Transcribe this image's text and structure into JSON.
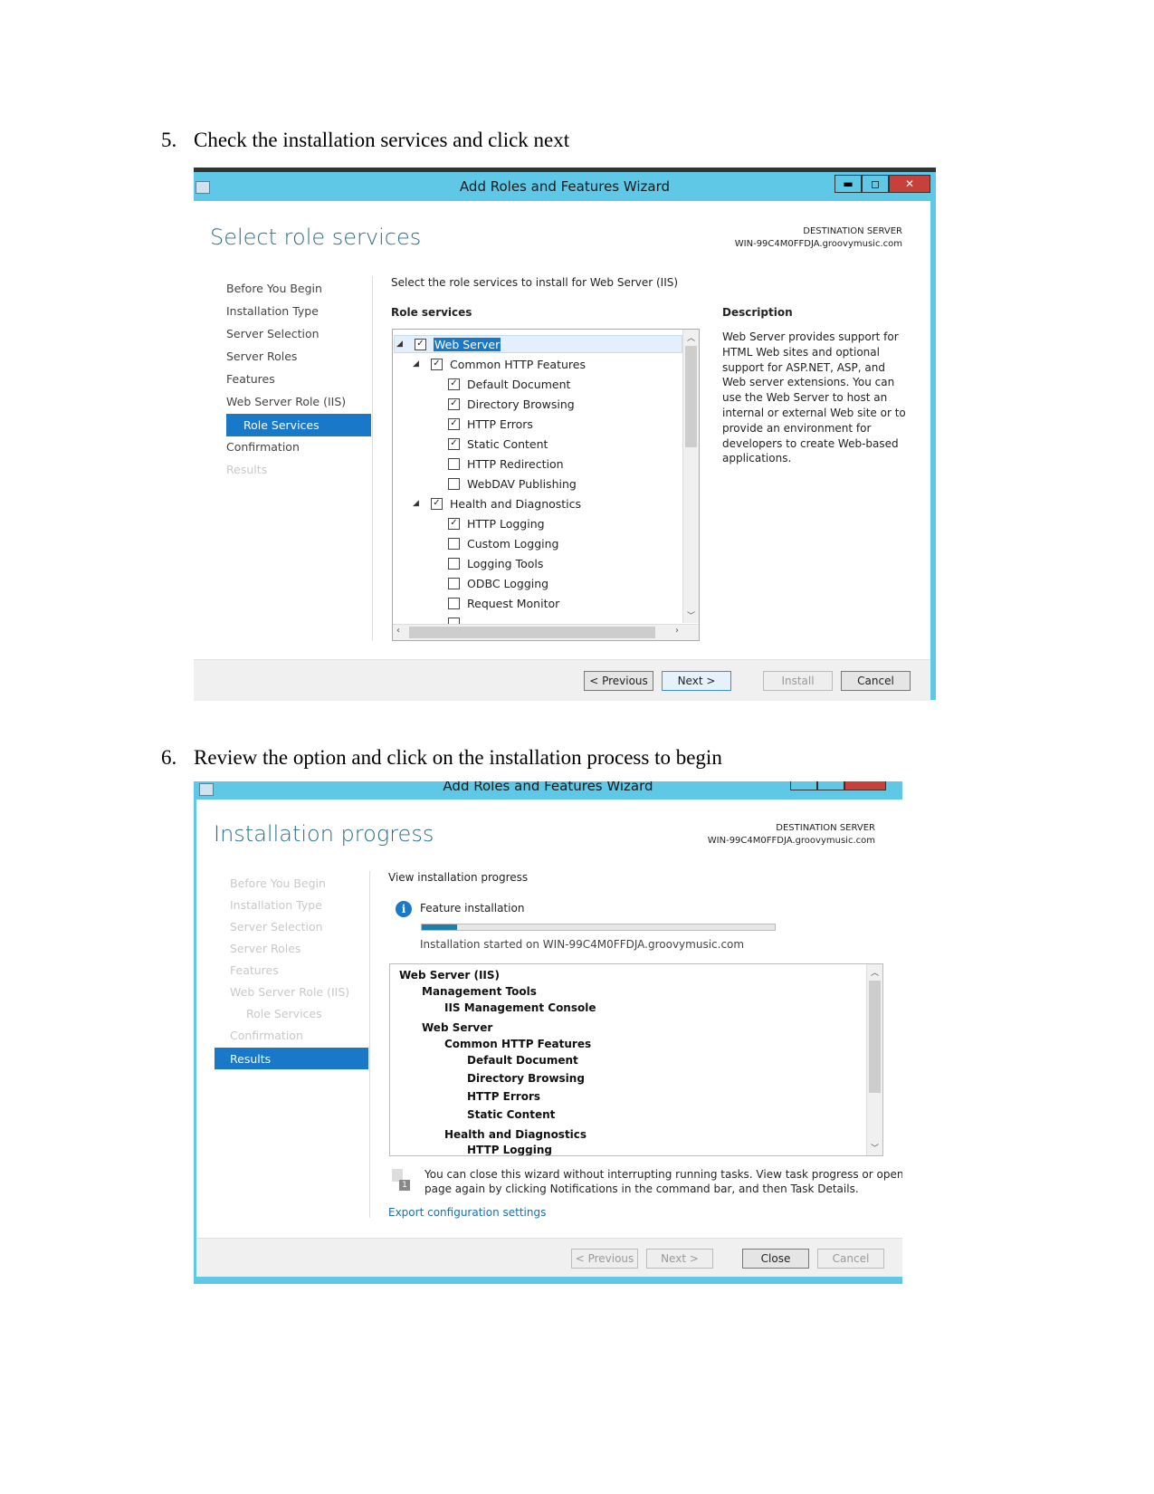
{
  "steps": [
    {
      "number": "5.",
      "text": "Check the installation services and click next"
    },
    {
      "number": "6.",
      "text": "Review the option and click on the installation process to begin"
    }
  ],
  "wizard1": {
    "title": "Add Roles and Features Wizard",
    "window_controls": {
      "minimize": "▬",
      "maximize": "◻",
      "close": "✕"
    },
    "heading": "Select role services",
    "destination_label": "DESTINATION SERVER",
    "destination_server": "WIN-99C4M0FFDJA.groovymusic.com",
    "nav": [
      "Before You Begin",
      "Installation Type",
      "Server Selection",
      "Server Roles",
      "Features",
      "Web Server Role (IIS)",
      "Role Services",
      "Confirmation",
      "Results"
    ],
    "nav_selected": "Role Services",
    "instruction": "Select the role services to install for Web Server (IIS)",
    "role_services_label": "Role services",
    "tree": [
      {
        "label": "Web Server",
        "checked": true,
        "level": 0,
        "expanded": true,
        "selected": true
      },
      {
        "label": "Common HTTP Features",
        "checked": true,
        "level": 1,
        "expanded": true
      },
      {
        "label": "Default Document",
        "checked": true,
        "level": 2
      },
      {
        "label": "Directory Browsing",
        "checked": true,
        "level": 2
      },
      {
        "label": "HTTP Errors",
        "checked": true,
        "level": 2
      },
      {
        "label": "Static Content",
        "checked": true,
        "level": 2
      },
      {
        "label": "HTTP Redirection",
        "checked": false,
        "level": 2
      },
      {
        "label": "WebDAV Publishing",
        "checked": false,
        "level": 2
      },
      {
        "label": "Health and Diagnostics",
        "checked": true,
        "level": 1,
        "expanded": true
      },
      {
        "label": "HTTP Logging",
        "checked": true,
        "level": 2
      },
      {
        "label": "Custom Logging",
        "checked": false,
        "level": 2
      },
      {
        "label": "Logging Tools",
        "checked": false,
        "level": 2
      },
      {
        "label": "ODBC Logging",
        "checked": false,
        "level": 2
      },
      {
        "label": "Request Monitor",
        "checked": false,
        "level": 2
      }
    ],
    "description_label": "Description",
    "description": "Web Server provides support for HTML Web sites and optional support for ASP.NET, ASP, and Web server extensions. You can use the Web Server to host an internal or external Web site or to provide an environment for developers to create Web-based applications.",
    "buttons": {
      "previous": "< Previous",
      "next": "Next >",
      "install": "Install",
      "cancel": "Cancel"
    }
  },
  "wizard2": {
    "title": "Add Roles and Features Wizard",
    "heading": "Installation progress",
    "destination_label": "DESTINATION SERVER",
    "destination_server": "WIN-99C4M0FFDJA.groovymusic.com",
    "nav": [
      "Before You Begin",
      "Installation Type",
      "Server Selection",
      "Server Roles",
      "Features",
      "Web Server Role (IIS)",
      "Role Services",
      "Confirmation",
      "Results"
    ],
    "nav_selected": "Results",
    "view_label": "View installation progress",
    "feature_installation": "Feature installation",
    "progress_percent": 10,
    "started_text": "Installation started on WIN-99C4M0FFDJA.groovymusic.com",
    "items": [
      {
        "label": "Web Server (IIS)",
        "level": 0
      },
      {
        "label": "Management Tools",
        "level": 1
      },
      {
        "label": "IIS Management Console",
        "level": 2
      },
      {
        "label": "Web Server",
        "level": 1
      },
      {
        "label": "Common HTTP Features",
        "level": 2
      },
      {
        "label": "Default Document",
        "level": 3
      },
      {
        "label": "Directory Browsing",
        "level": 3
      },
      {
        "label": "HTTP Errors",
        "level": 3
      },
      {
        "label": "Static Content",
        "level": 3
      },
      {
        "label": "Health and Diagnostics",
        "level": 2
      },
      {
        "label": "HTTP Logging",
        "level": 3
      }
    ],
    "notice_line1": "You can close this wizard without interrupting running tasks. View task progress or open this",
    "notice_line2": "page again by clicking Notifications in the command bar, and then Task Details.",
    "notice_badge": "1",
    "export_link": "Export configuration settings",
    "buttons": {
      "previous": "< Previous",
      "next": "Next >",
      "close": "Close",
      "cancel": "Cancel"
    }
  },
  "colors": {
    "titlebar": "#5ec8e6",
    "selected_nav": "#1a78c8",
    "heading": "#2c6e8a",
    "progress": "#1f7fa8",
    "close_button": "#c7413a"
  }
}
